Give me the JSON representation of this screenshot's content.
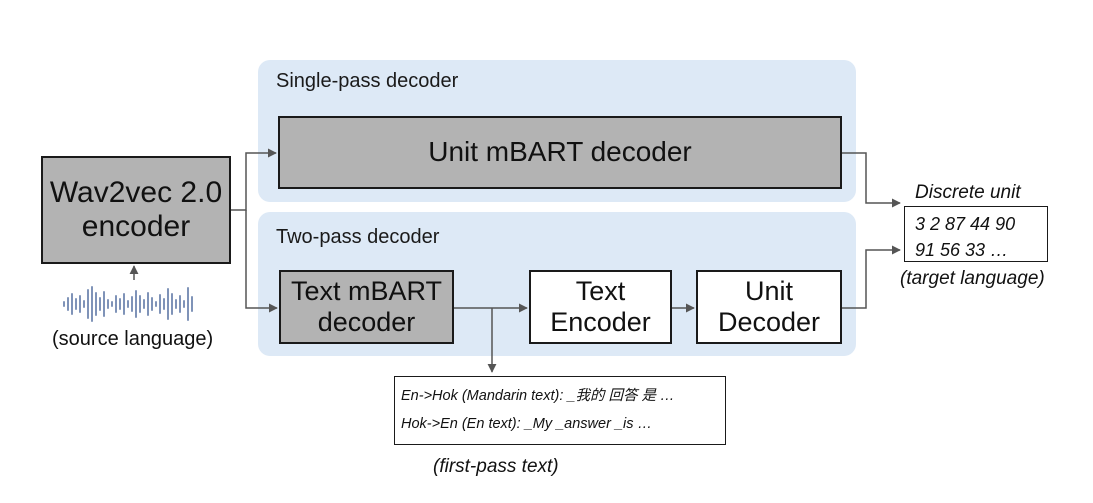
{
  "panels": {
    "single_pass": {
      "title": "Single-pass decoder"
    },
    "two_pass": {
      "title": "Two-pass decoder"
    }
  },
  "blocks": {
    "encoder": {
      "lines": [
        "Wav2vec 2.0",
        "encoder"
      ],
      "fill": "#b3b3b3"
    },
    "unit_mbart": {
      "lines": [
        "Unit mBART decoder"
      ],
      "fill": "#b3b3b3"
    },
    "text_mbart": {
      "lines": [
        "Text mBART",
        "decoder"
      ],
      "fill": "#b3b3b3"
    },
    "text_encoder": {
      "lines": [
        "Text",
        "Encoder"
      ],
      "fill": "#ffffff"
    },
    "unit_decoder": {
      "lines": [
        "Unit",
        "Decoder"
      ],
      "fill": "#ffffff"
    }
  },
  "labels": {
    "source_language": "(source language)",
    "discrete_unit": "Discrete unit",
    "target_language": "(target language)",
    "first_pass_text": "(first-pass text)"
  },
  "discrete_units": {
    "line1": "3 2 87 44 90",
    "line2": "91 56 33 …"
  },
  "first_pass_examples": {
    "line1": "En->Hok (Mandarin text): _我的 回答 是 …",
    "line2": "Hok->En (En text): _My _answer _is …"
  },
  "colors": {
    "panel_bg": "#dde9f6",
    "gray_block": "#b3b3b3",
    "waveform": "#7f93b8",
    "arrow": "#555555"
  },
  "icons": {
    "waveform": "audio-waveform-icon"
  }
}
